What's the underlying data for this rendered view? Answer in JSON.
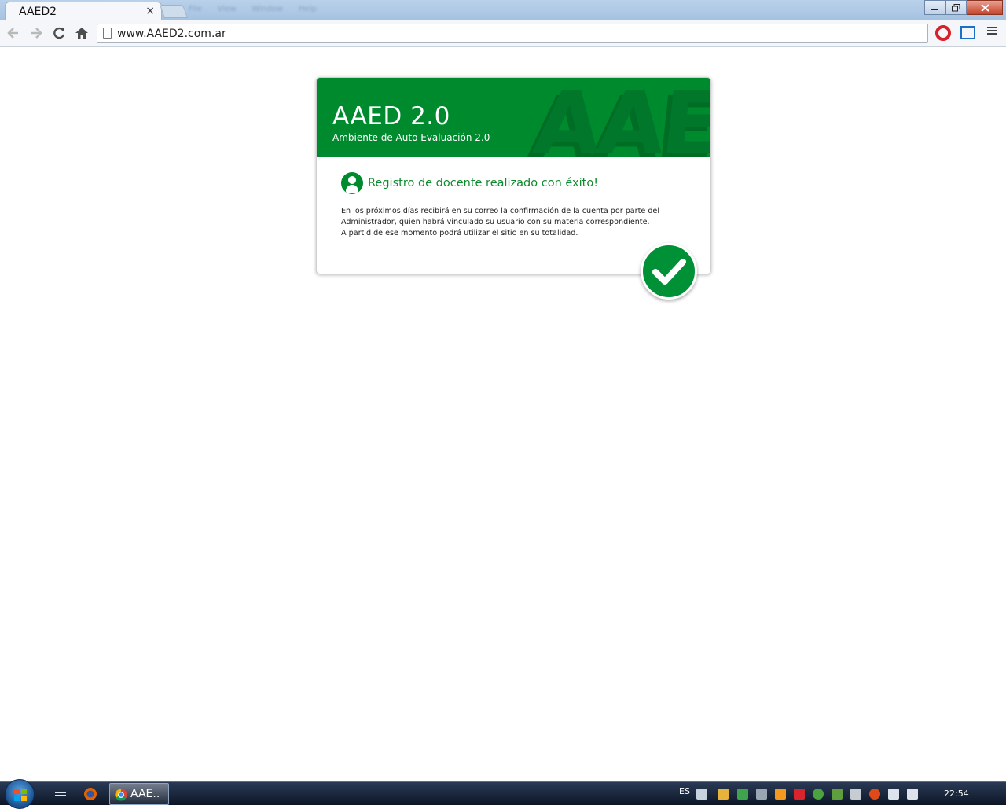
{
  "browser": {
    "tab_title": "AAED2",
    "tab_close": "×",
    "url": "www.AAED2.com.ar",
    "icons": [
      "back-icon",
      "forward-icon",
      "reload-icon",
      "home-icon",
      "page-icon",
      "opera-extension-icon",
      "screen-capture-icon",
      "chrome-menu-icon"
    ]
  },
  "background_window_menu": [
    "File",
    "View",
    "Window",
    "Help"
  ],
  "card": {
    "title": "AAED 2.0",
    "subtitle": "Ambiente de Auto Evaluación 2.0",
    "watermark": "AAED",
    "success_title": "Registro de docente realizado con éxito!",
    "message_lines": [
      "En los próximos días recibirá en su correo la confirmación de la cuenta por parte del",
      "Administrador, quien habrá vinculado su usuario con su materia correspondiente.",
      "A partid de ese momento podrá utilizar el sitio en su totalidad."
    ],
    "accent_color": "#008a2e"
  },
  "taskbar": {
    "task_label": "AAE..",
    "language": "ES",
    "clock": "22:54"
  }
}
